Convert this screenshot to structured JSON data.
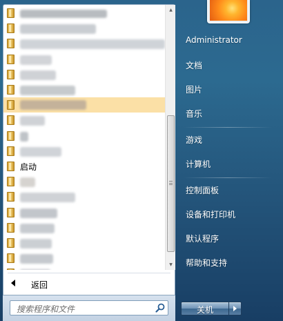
{
  "user": {
    "name": "Administrator"
  },
  "programs": {
    "items": [
      {
        "label": "",
        "highlighted": false
      },
      {
        "label": "",
        "highlighted": false
      },
      {
        "label": "",
        "highlighted": false
      },
      {
        "label": "",
        "highlighted": false
      },
      {
        "label": "",
        "highlighted": false
      },
      {
        "label": "",
        "highlighted": false
      },
      {
        "label": "",
        "highlighted": true
      },
      {
        "label": "",
        "highlighted": false
      },
      {
        "label": "",
        "highlighted": false
      },
      {
        "label": "",
        "highlighted": false
      },
      {
        "label": "启动",
        "highlighted": false
      },
      {
        "label": "",
        "highlighted": false
      },
      {
        "label": "",
        "highlighted": false
      },
      {
        "label": "",
        "highlighted": false
      },
      {
        "label": "",
        "highlighted": false
      },
      {
        "label": "",
        "highlighted": false
      },
      {
        "label": "",
        "highlighted": false
      },
      {
        "label": "",
        "highlighted": false
      }
    ],
    "back_label": "返回"
  },
  "search": {
    "placeholder": "搜索程序和文件"
  },
  "right_menu": {
    "documents": "文档",
    "pictures": "图片",
    "music": "音乐",
    "games": "游戏",
    "computer": "计算机",
    "control_panel": "控制面板",
    "devices_printers": "设备和打印机",
    "default_programs": "默认程序",
    "help_support": "帮助和支持"
  },
  "shutdown": {
    "label": "关机"
  },
  "colors": {
    "highlight": "#fbe0a6",
    "panel_blue": "#2b648c",
    "folder": "#e8c35a"
  }
}
